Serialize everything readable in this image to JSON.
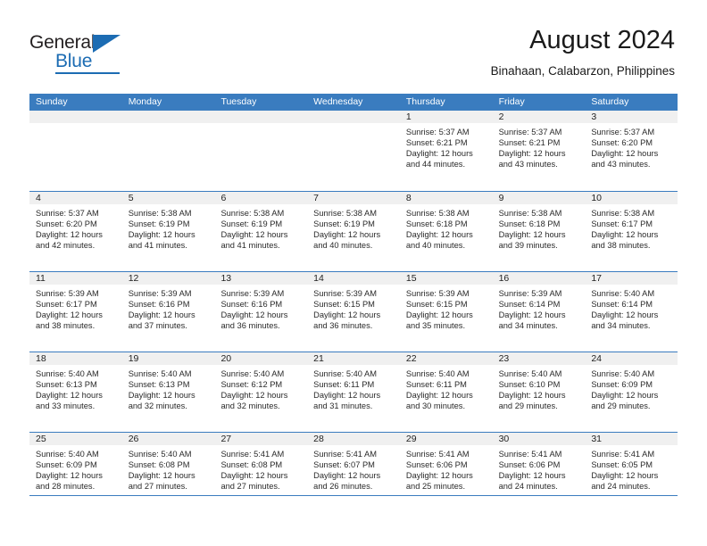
{
  "brand": {
    "name_part1": "General",
    "name_part2": "Blue"
  },
  "header": {
    "title": "August 2024",
    "subtitle": "Binahaan, Calabarzon, Philippines"
  },
  "theme": {
    "header_blue": "#3a7cbf",
    "brand_blue": "#1c6cb3",
    "cell_head_gray": "#f0f0f0"
  },
  "weekdays": [
    "Sunday",
    "Monday",
    "Tuesday",
    "Wednesday",
    "Thursday",
    "Friday",
    "Saturday"
  ],
  "weeks": [
    [
      {
        "day": "",
        "lines": []
      },
      {
        "day": "",
        "lines": []
      },
      {
        "day": "",
        "lines": []
      },
      {
        "day": "",
        "lines": []
      },
      {
        "day": "1",
        "lines": [
          "Sunrise: 5:37 AM",
          "Sunset: 6:21 PM",
          "Daylight: 12 hours",
          "and 44 minutes."
        ]
      },
      {
        "day": "2",
        "lines": [
          "Sunrise: 5:37 AM",
          "Sunset: 6:21 PM",
          "Daylight: 12 hours",
          "and 43 minutes."
        ]
      },
      {
        "day": "3",
        "lines": [
          "Sunrise: 5:37 AM",
          "Sunset: 6:20 PM",
          "Daylight: 12 hours",
          "and 43 minutes."
        ]
      }
    ],
    [
      {
        "day": "4",
        "lines": [
          "Sunrise: 5:37 AM",
          "Sunset: 6:20 PM",
          "Daylight: 12 hours",
          "and 42 minutes."
        ]
      },
      {
        "day": "5",
        "lines": [
          "Sunrise: 5:38 AM",
          "Sunset: 6:19 PM",
          "Daylight: 12 hours",
          "and 41 minutes."
        ]
      },
      {
        "day": "6",
        "lines": [
          "Sunrise: 5:38 AM",
          "Sunset: 6:19 PM",
          "Daylight: 12 hours",
          "and 41 minutes."
        ]
      },
      {
        "day": "7",
        "lines": [
          "Sunrise: 5:38 AM",
          "Sunset: 6:19 PM",
          "Daylight: 12 hours",
          "and 40 minutes."
        ]
      },
      {
        "day": "8",
        "lines": [
          "Sunrise: 5:38 AM",
          "Sunset: 6:18 PM",
          "Daylight: 12 hours",
          "and 40 minutes."
        ]
      },
      {
        "day": "9",
        "lines": [
          "Sunrise: 5:38 AM",
          "Sunset: 6:18 PM",
          "Daylight: 12 hours",
          "and 39 minutes."
        ]
      },
      {
        "day": "10",
        "lines": [
          "Sunrise: 5:38 AM",
          "Sunset: 6:17 PM",
          "Daylight: 12 hours",
          "and 38 minutes."
        ]
      }
    ],
    [
      {
        "day": "11",
        "lines": [
          "Sunrise: 5:39 AM",
          "Sunset: 6:17 PM",
          "Daylight: 12 hours",
          "and 38 minutes."
        ]
      },
      {
        "day": "12",
        "lines": [
          "Sunrise: 5:39 AM",
          "Sunset: 6:16 PM",
          "Daylight: 12 hours",
          "and 37 minutes."
        ]
      },
      {
        "day": "13",
        "lines": [
          "Sunrise: 5:39 AM",
          "Sunset: 6:16 PM",
          "Daylight: 12 hours",
          "and 36 minutes."
        ]
      },
      {
        "day": "14",
        "lines": [
          "Sunrise: 5:39 AM",
          "Sunset: 6:15 PM",
          "Daylight: 12 hours",
          "and 36 minutes."
        ]
      },
      {
        "day": "15",
        "lines": [
          "Sunrise: 5:39 AM",
          "Sunset: 6:15 PM",
          "Daylight: 12 hours",
          "and 35 minutes."
        ]
      },
      {
        "day": "16",
        "lines": [
          "Sunrise: 5:39 AM",
          "Sunset: 6:14 PM",
          "Daylight: 12 hours",
          "and 34 minutes."
        ]
      },
      {
        "day": "17",
        "lines": [
          "Sunrise: 5:40 AM",
          "Sunset: 6:14 PM",
          "Daylight: 12 hours",
          "and 34 minutes."
        ]
      }
    ],
    [
      {
        "day": "18",
        "lines": [
          "Sunrise: 5:40 AM",
          "Sunset: 6:13 PM",
          "Daylight: 12 hours",
          "and 33 minutes."
        ]
      },
      {
        "day": "19",
        "lines": [
          "Sunrise: 5:40 AM",
          "Sunset: 6:13 PM",
          "Daylight: 12 hours",
          "and 32 minutes."
        ]
      },
      {
        "day": "20",
        "lines": [
          "Sunrise: 5:40 AM",
          "Sunset: 6:12 PM",
          "Daylight: 12 hours",
          "and 32 minutes."
        ]
      },
      {
        "day": "21",
        "lines": [
          "Sunrise: 5:40 AM",
          "Sunset: 6:11 PM",
          "Daylight: 12 hours",
          "and 31 minutes."
        ]
      },
      {
        "day": "22",
        "lines": [
          "Sunrise: 5:40 AM",
          "Sunset: 6:11 PM",
          "Daylight: 12 hours",
          "and 30 minutes."
        ]
      },
      {
        "day": "23",
        "lines": [
          "Sunrise: 5:40 AM",
          "Sunset: 6:10 PM",
          "Daylight: 12 hours",
          "and 29 minutes."
        ]
      },
      {
        "day": "24",
        "lines": [
          "Sunrise: 5:40 AM",
          "Sunset: 6:09 PM",
          "Daylight: 12 hours",
          "and 29 minutes."
        ]
      }
    ],
    [
      {
        "day": "25",
        "lines": [
          "Sunrise: 5:40 AM",
          "Sunset: 6:09 PM",
          "Daylight: 12 hours",
          "and 28 minutes."
        ]
      },
      {
        "day": "26",
        "lines": [
          "Sunrise: 5:40 AM",
          "Sunset: 6:08 PM",
          "Daylight: 12 hours",
          "and 27 minutes."
        ]
      },
      {
        "day": "27",
        "lines": [
          "Sunrise: 5:41 AM",
          "Sunset: 6:08 PM",
          "Daylight: 12 hours",
          "and 27 minutes."
        ]
      },
      {
        "day": "28",
        "lines": [
          "Sunrise: 5:41 AM",
          "Sunset: 6:07 PM",
          "Daylight: 12 hours",
          "and 26 minutes."
        ]
      },
      {
        "day": "29",
        "lines": [
          "Sunrise: 5:41 AM",
          "Sunset: 6:06 PM",
          "Daylight: 12 hours",
          "and 25 minutes."
        ]
      },
      {
        "day": "30",
        "lines": [
          "Sunrise: 5:41 AM",
          "Sunset: 6:06 PM",
          "Daylight: 12 hours",
          "and 24 minutes."
        ]
      },
      {
        "day": "31",
        "lines": [
          "Sunrise: 5:41 AM",
          "Sunset: 6:05 PM",
          "Daylight: 12 hours",
          "and 24 minutes."
        ]
      }
    ]
  ]
}
